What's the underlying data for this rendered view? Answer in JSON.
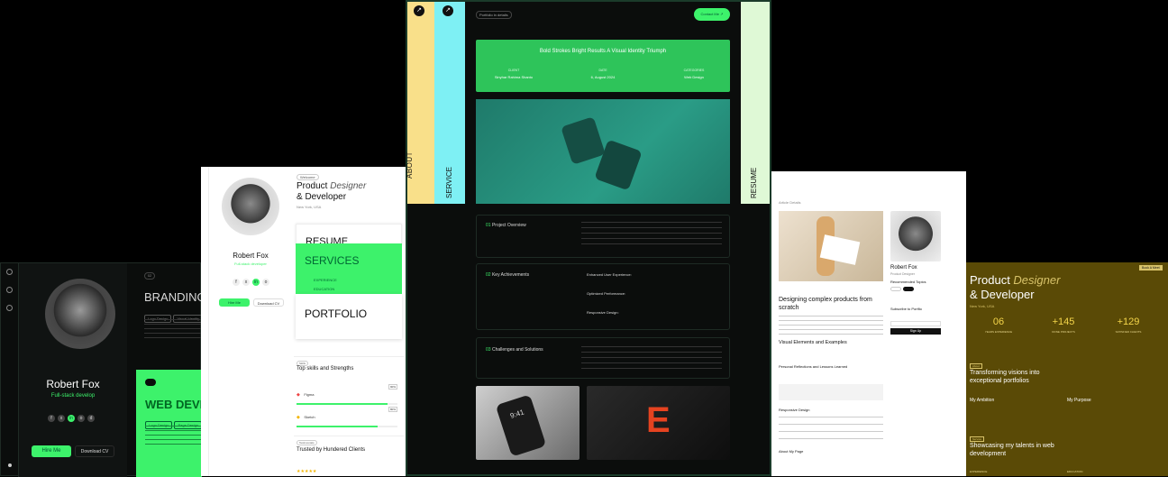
{
  "panel1": {
    "name": "Robert Fox",
    "role": "Full-stack develop",
    "hire_btn": "Hire Me",
    "cv_btn": "Download CV",
    "branding": "BRANDING",
    "web_dev": "WEB DEVE",
    "tags_a": [
      "Logo Design",
      "Visual Identity"
    ],
    "tags_b": [
      "Logo Design",
      "Page Design"
    ],
    "side_counter": "02"
  },
  "panel2": {
    "tag": "Welcome",
    "title_a": "Product ",
    "title_italic": "Designer",
    "title_b": "& Developer",
    "location": "New York, USA",
    "name": "Robert Fox",
    "role": "Full-stack developer",
    "hire_btn": "Hire Me",
    "cv_btn": "Download CV",
    "resume": "RESUME",
    "services": "SERVICES",
    "services_sub": [
      "EXPERIENCE",
      "EDUCATION"
    ],
    "portfolio": "PORTFOLIO",
    "skills_tag": "Skills",
    "skills_title": "Top skills and Strengths",
    "skills": [
      {
        "name": "Figma",
        "pct": "90%"
      },
      {
        "name": "Sketch",
        "pct": "80%"
      }
    ],
    "clients_tag": "Testimonials",
    "clients_title": "Trusted by Hundered Clients"
  },
  "panel3": {
    "breadcrumb": "Portfolio in details",
    "contact_btn": "Contact Me",
    "tabs": [
      "ABOUT",
      "SERVICE",
      "RESUME"
    ],
    "hero_title": "Bold Strokes Bright Results A Visual Identity Triumph",
    "meta": [
      {
        "label": "CLIENT",
        "value": "Sinyhar Rahima Shanto"
      },
      {
        "label": "DATE",
        "value": "6, August 2024"
      },
      {
        "label": "CATEGORIES",
        "value": "Web Design"
      }
    ],
    "sections": [
      {
        "num": "01",
        "title": "Project Overview"
      },
      {
        "num": "02",
        "title": "Key Achievements"
      },
      {
        "num": "03",
        "title": "Challenges and Solutions"
      }
    ],
    "achievements": [
      "Enhanced User Experience:",
      "Optimized Performance:",
      "Responsive Design:"
    ],
    "phone_time": "9:41"
  },
  "panel4": {
    "breadcrumb": "Article Details",
    "title": "Designing complex products from scratch",
    "h_visual": "Visual Elements and Examples",
    "h_personal": "Personal Reflections and Lessons Learned",
    "h_responsive": "Responsive Design",
    "h_about": "About My Page",
    "name": "Robert Fox",
    "role": "Product Designer",
    "topics_title": "Recommended Topics",
    "subscribe": "Subscribe to Portfio",
    "signup": "Sign Up"
  },
  "panel5": {
    "button": "Book A Meet",
    "title_a": "Product ",
    "title_italic": "Designer",
    "title_b": "& Developer",
    "location": "New York, USA",
    "stats": [
      {
        "value": "06",
        "label": "YEARS EXPERIENCE"
      },
      {
        "value": "+145",
        "label": "DONE PROJECTS"
      },
      {
        "value": "+129",
        "label": "SATISFIED CLIENTS"
      }
    ],
    "tag": "About",
    "heading": "Transforming visions into exceptional portfolios",
    "ambition": "My Ambition",
    "purpose": "My Purpose",
    "tag2": "Service",
    "heading2": "Showcasing my talents in web development",
    "foot": [
      "EXPERIENCE",
      "EDUCATION"
    ]
  },
  "colors": {
    "accent": "#3df26b",
    "dark": "#0b0d0c",
    "olive": "#5a4a06",
    "yellow": "#f9e08a",
    "cyan": "#7ef0f4",
    "mint": "#dff9d6"
  }
}
